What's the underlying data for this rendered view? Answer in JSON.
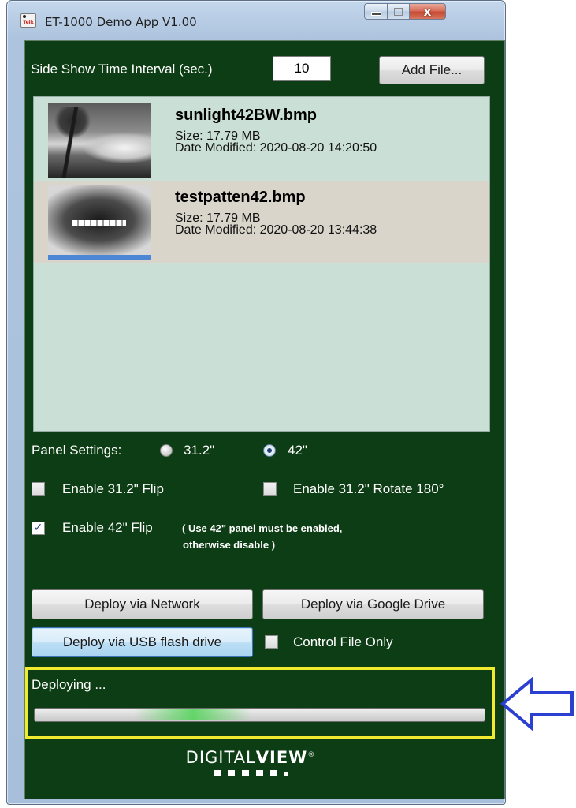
{
  "window": {
    "title": "ET-1000 Demo App V1.00",
    "icon_text": "Teik",
    "close_glyph": "x"
  },
  "slideshow": {
    "interval_label": "Side Show Time Interval (sec.)",
    "interval_value": "10",
    "add_file_label": "Add File..."
  },
  "files": [
    {
      "name": "sunlight42BW.bmp",
      "size": "Size: 17.79 MB",
      "date": "Date Modified: 2020-08-20 14:20:50",
      "thumbnail": "landscape-photo-bw",
      "selected": false
    },
    {
      "name": "testpatten42.bmp",
      "size": "Size: 17.79 MB",
      "date": "Date Modified: 2020-08-20 13:44:38",
      "thumbnail": "test-pattern",
      "selected": true
    }
  ],
  "panel": {
    "label": "Panel Settings:",
    "options": [
      {
        "label": "31.2\"",
        "checked": false
      },
      {
        "label": "42\"",
        "checked": true
      }
    ]
  },
  "options": {
    "flip_31": {
      "label": "Enable 31.2\" Flip",
      "checked": false
    },
    "rotate_31": {
      "label": "Enable 31.2\" Rotate 180°",
      "checked": false
    },
    "flip_42": {
      "label": "Enable 42\" Flip",
      "checked": true
    },
    "flip_42_note_line1": "( Use 42\" panel must be enabled,",
    "flip_42_note_line2": "otherwise disable )",
    "control_only": {
      "label": "Control File Only",
      "checked": false
    }
  },
  "deploy": {
    "network": "Deploy via Network",
    "google_drive": "Deploy via Google Drive",
    "usb": "Deploy via USB flash drive"
  },
  "progress": {
    "status": "Deploying ...",
    "glow_position": 0.22
  },
  "logo": {
    "part1": "DIGITAL",
    "part2": "VIEW",
    "mark": "®"
  },
  "colors": {
    "client_bg": "#0d3d14",
    "list_bg": "#cadfd6",
    "selected_row": "#d9d5cb",
    "highlight_frame": "#f1ea2e",
    "annotation_arrow": "#2b3fd0",
    "progress_glow": "#56d45c"
  },
  "icons": {
    "app": "tek-app-icon",
    "minimize": "minimize-icon",
    "maximize": "maximize-icon",
    "close": "close-icon",
    "annotation": "outline-arrow-left-icon"
  }
}
